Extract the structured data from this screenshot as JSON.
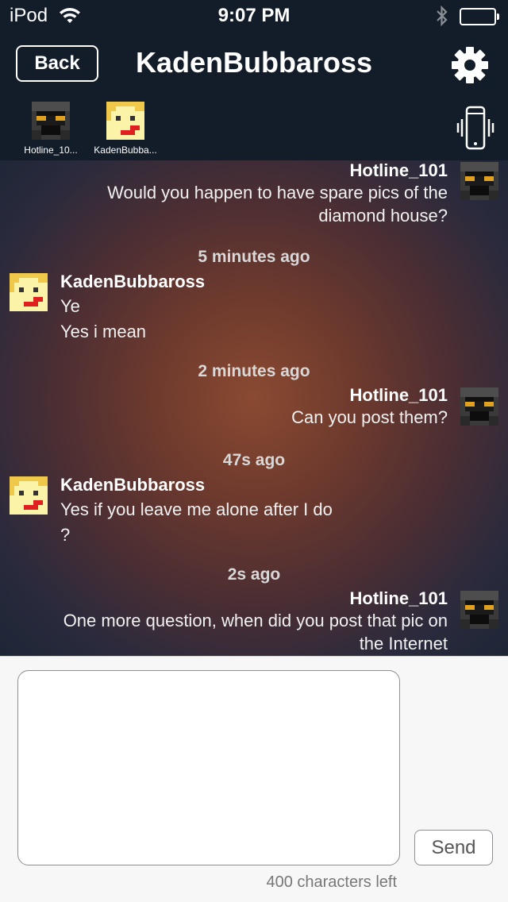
{
  "status_bar": {
    "carrier": "iPod",
    "time": "9:07 PM"
  },
  "nav": {
    "back_label": "Back",
    "title": "KadenBubbaross",
    "settings_icon": "gear-icon"
  },
  "participants": [
    {
      "name": "Hotline_10...",
      "avatar": "dark-robot-avatar"
    },
    {
      "name": "KadenBubba...",
      "avatar": "yellow-face-avatar"
    }
  ],
  "chat": {
    "messages": [
      {
        "sender": "Hotline_101",
        "side": "right",
        "lines": [
          "Would you happen to have spare pics of the",
          "diamond house?"
        ]
      },
      {
        "timestamp": "5 minutes ago"
      },
      {
        "sender": "KadenBubbaross",
        "side": "left",
        "lines": [
          "Ye",
          "Yes i mean"
        ]
      },
      {
        "timestamp": "2 minutes ago"
      },
      {
        "sender": "Hotline_101",
        "side": "right",
        "lines": [
          "Can you post them?"
        ]
      },
      {
        "timestamp": "47s ago"
      },
      {
        "sender": "KadenBubbaross",
        "side": "left",
        "lines": [
          "Yes if you leave me alone after I do",
          "?"
        ]
      },
      {
        "timestamp": "2s ago"
      },
      {
        "sender": "Hotline_101",
        "side": "right",
        "lines": [
          "One more question, when did you post that pic on",
          "the Internet"
        ]
      }
    ]
  },
  "composer": {
    "input_value": "",
    "send_label": "Send",
    "chars_left": "400 characters left"
  },
  "colors": {
    "bar_background": "#131d29",
    "composer_background": "#f7f7f7",
    "robot_eye": "#e0a020",
    "face_skin": "#fbf3a8",
    "face_mouth": "#e02020"
  }
}
